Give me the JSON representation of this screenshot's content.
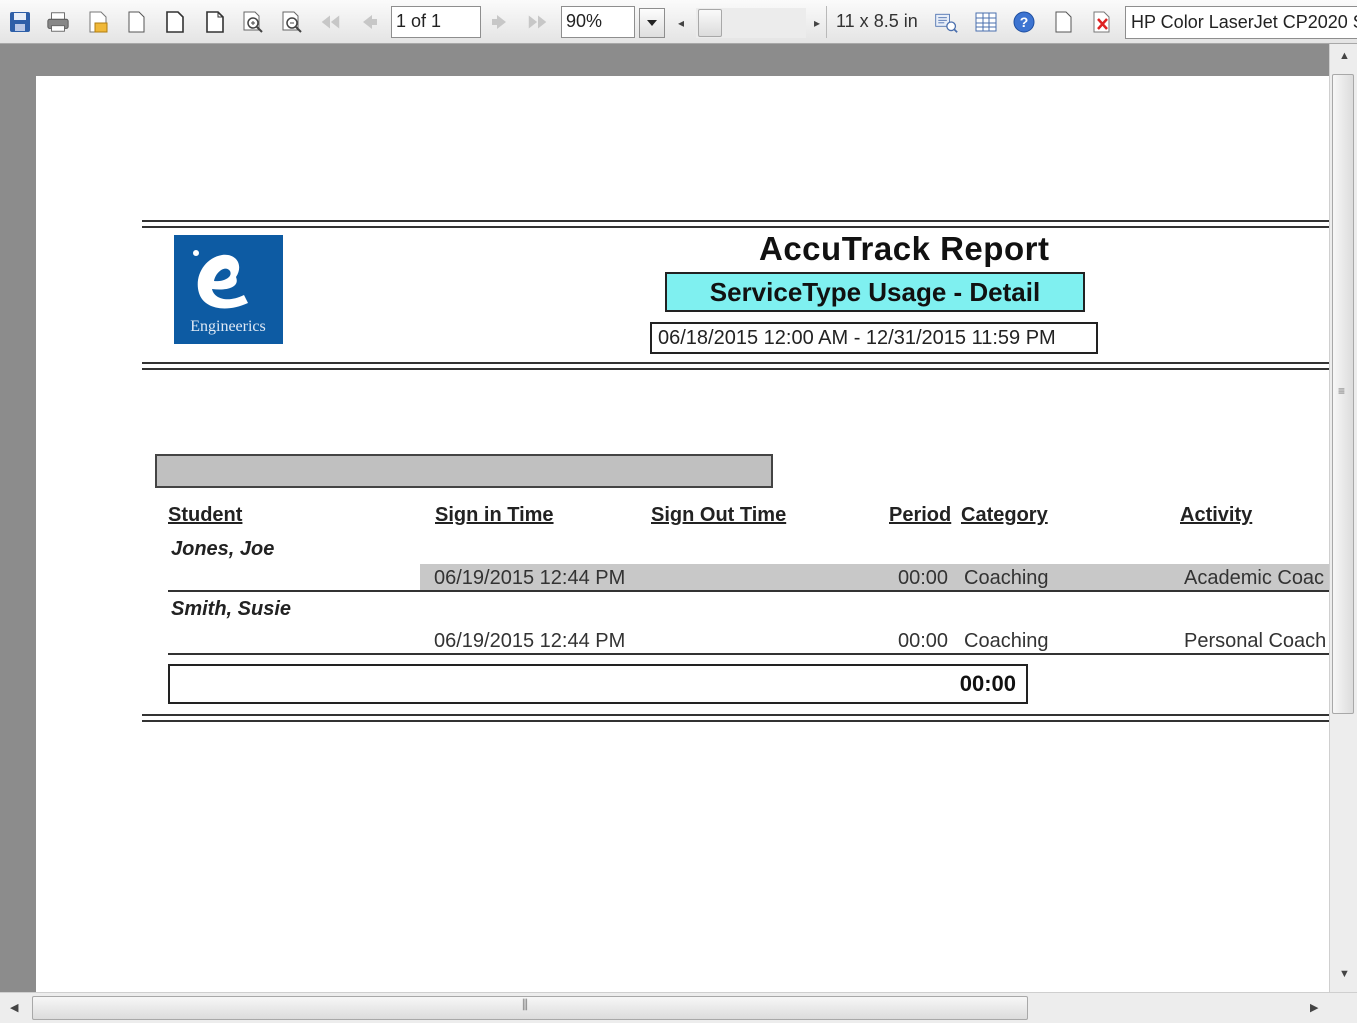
{
  "toolbar": {
    "page_indicator": "1 of 1",
    "zoom": "90%",
    "paper_size": "11 x 8.5 in",
    "printer": "HP Color LaserJet CP2020 S"
  },
  "report": {
    "title": "AccuTrack Report",
    "subtitle": "ServiceType Usage - Detail",
    "date_range": "06/18/2015 12:00 AM   -  12/31/2015 11:59 PM",
    "logo_text": "Engineerics",
    "columns": {
      "student": "Student",
      "sign_in": "Sign in Time",
      "sign_out": "Sign Out Time",
      "period": "Period",
      "category": "Category",
      "activity": "Activity"
    },
    "rows": [
      {
        "student": "Jones, Joe",
        "sign_in": "06/19/2015 12:44 PM",
        "sign_out": "",
        "period": "00:00",
        "category": "Coaching",
        "activity": "Academic Coac"
      },
      {
        "student": "Smith, Susie",
        "sign_in": "06/19/2015 12:44 PM",
        "sign_out": "",
        "period": "00:00",
        "category": "Coaching",
        "activity": "Personal Coach"
      }
    ],
    "total": "00:00"
  },
  "icons": [
    "save-icon",
    "print-icon",
    "export-icon",
    "page-icon",
    "single-page-icon",
    "multi-page-icon",
    "zoom-in-icon",
    "zoom-out-icon",
    "first-page-icon",
    "prev-page-icon",
    "next-page-icon",
    "last-page-icon",
    "page-setup-icon",
    "table-icon",
    "help-icon",
    "new-page-icon",
    "close-icon"
  ]
}
